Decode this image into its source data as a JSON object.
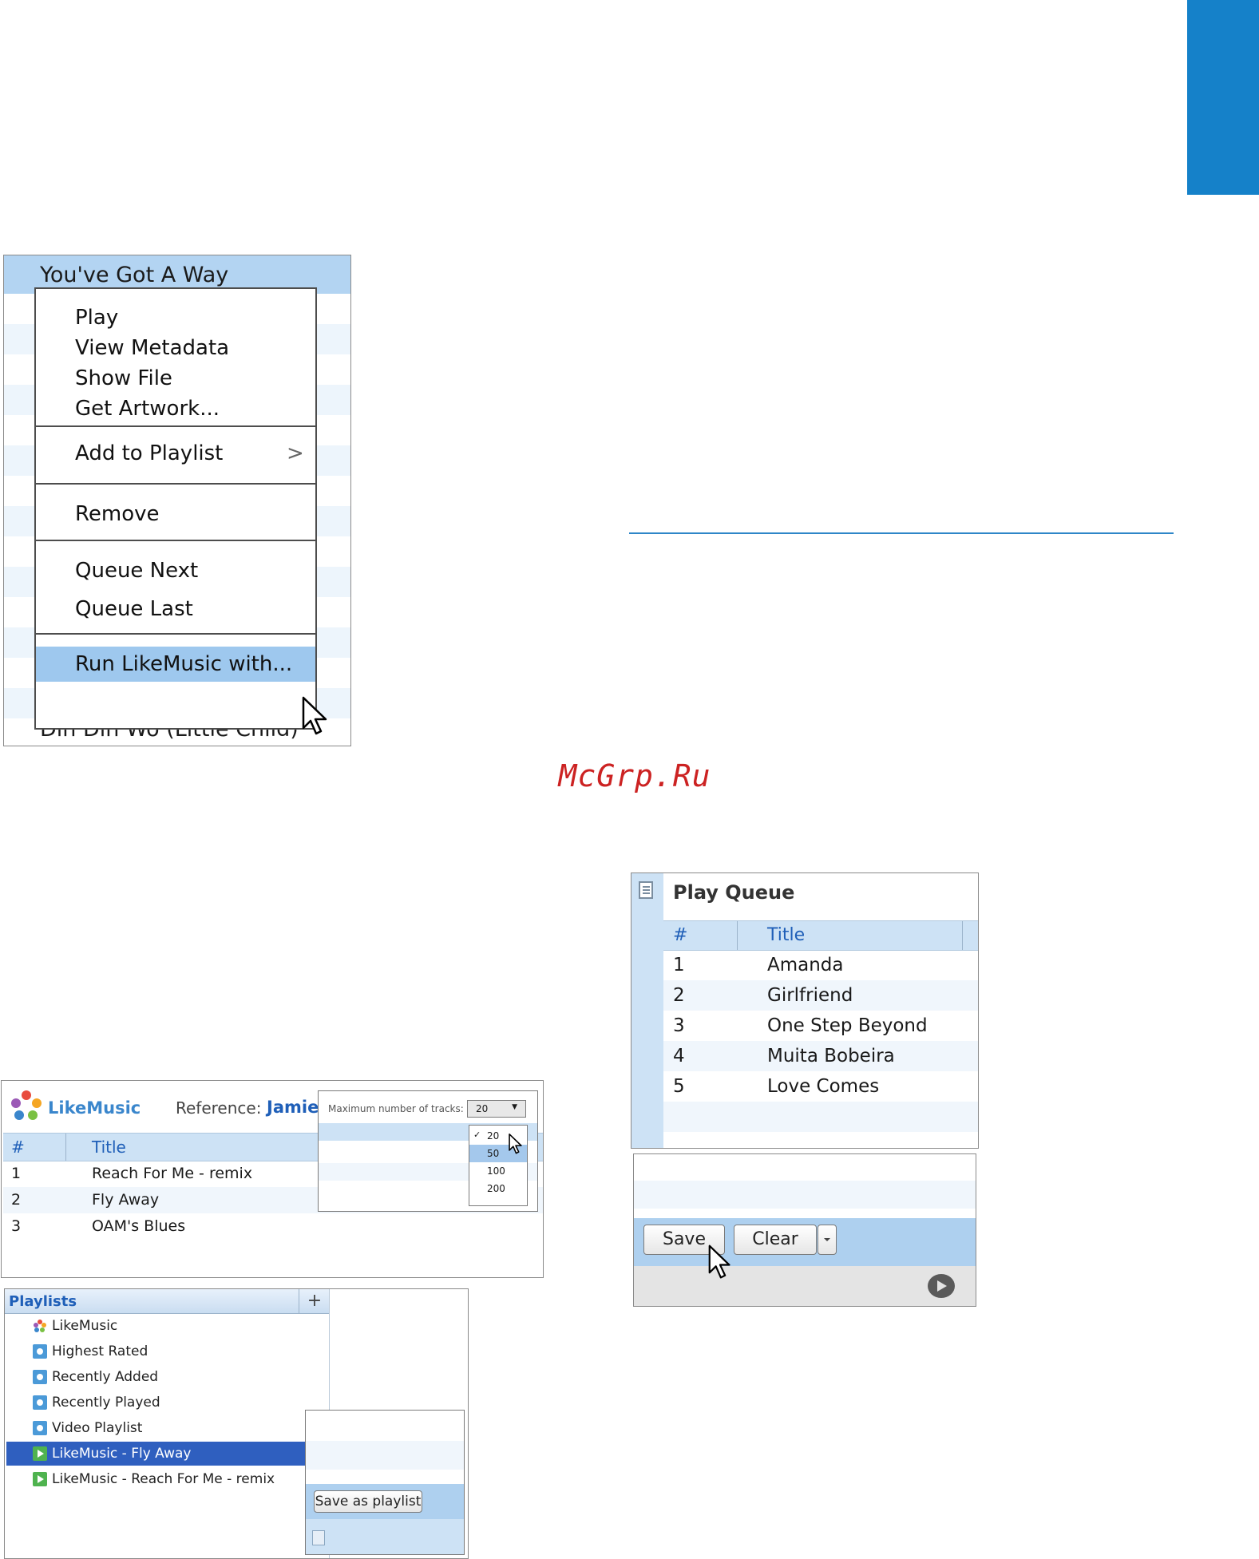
{
  "watermark": "McGrp.Ru",
  "context_menu": {
    "selected_row": "You've Got A Way",
    "bottom_row": "Din Din Wo (Little Child)",
    "items": [
      "Play",
      "View Metadata",
      "Show File",
      "Get Artwork...",
      "Add to Playlist",
      "Remove",
      "Queue Next",
      "Queue Last",
      "Run LikeMusic with..."
    ],
    "submenu_arrow": ">"
  },
  "play_queue": {
    "title": "Play Queue",
    "columns": [
      "#",
      "Title"
    ],
    "rows": [
      {
        "num": "1",
        "title": "Amanda"
      },
      {
        "num": "2",
        "title": "Girlfriend"
      },
      {
        "num": "3",
        "title": "One Step Beyond"
      },
      {
        "num": "4",
        "title": "Muita Bobeira"
      },
      {
        "num": "5",
        "title": "Love Comes"
      }
    ],
    "save_label": "Save",
    "clear_label": "Clear"
  },
  "likemusic": {
    "app_name": "LikeMusic",
    "reference_label": "Reference:",
    "reference_value": "Jamie",
    "columns": [
      "#",
      "Title"
    ],
    "rows": [
      {
        "num": "1",
        "title": "Reach For Me - remix"
      },
      {
        "num": "2",
        "title": "Fly Away"
      },
      {
        "num": "3",
        "title": "OAM's Blues"
      }
    ],
    "max_tracks_label": "Maximum number of tracks:",
    "max_tracks_value": "20",
    "max_tracks_options": [
      "20",
      "50",
      "100",
      "200"
    ]
  },
  "playlists": {
    "title": "Playlists",
    "add_label": "+",
    "items": [
      {
        "label": "LikeMusic",
        "icon": "likemusic-icon"
      },
      {
        "label": "Highest Rated",
        "icon": "smart-playlist-icon"
      },
      {
        "label": "Recently Added",
        "icon": "smart-playlist-icon"
      },
      {
        "label": "Recently Played",
        "icon": "smart-playlist-icon"
      },
      {
        "label": "Video Playlist",
        "icon": "smart-playlist-icon"
      },
      {
        "label": "LikeMusic - Fly Away",
        "icon": "playlist-icon"
      },
      {
        "label": "LikeMusic - Reach For Me - remix",
        "icon": "playlist-icon"
      }
    ],
    "save_as_playlist_label": "Save as playlist"
  },
  "colors": {
    "accent_blue": "#1581c9",
    "selection_blue": "#2f5fbf",
    "watermark_red": "#cc2222"
  }
}
